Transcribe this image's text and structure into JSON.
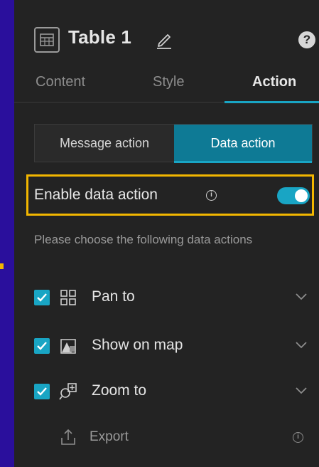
{
  "header": {
    "title": "Table 1"
  },
  "tabs": [
    {
      "label": "Content"
    },
    {
      "label": "Style"
    },
    {
      "label": "Action"
    }
  ],
  "segmented": {
    "left_label": "Message action",
    "right_label": "Data action"
  },
  "enable": {
    "label": "Enable data action",
    "info_glyph": "i"
  },
  "description": "Please choose the following data actions",
  "actions": [
    {
      "label": "Pan to"
    },
    {
      "label": "Show on map"
    },
    {
      "label": "Zoom to"
    }
  ],
  "export": {
    "label": "Export",
    "info_glyph": "i"
  },
  "help_glyph": "?",
  "colors": {
    "accent": "#19a5c4",
    "highlight": "#f2b600",
    "panel": "#232323",
    "background": "#2a0f9c"
  }
}
